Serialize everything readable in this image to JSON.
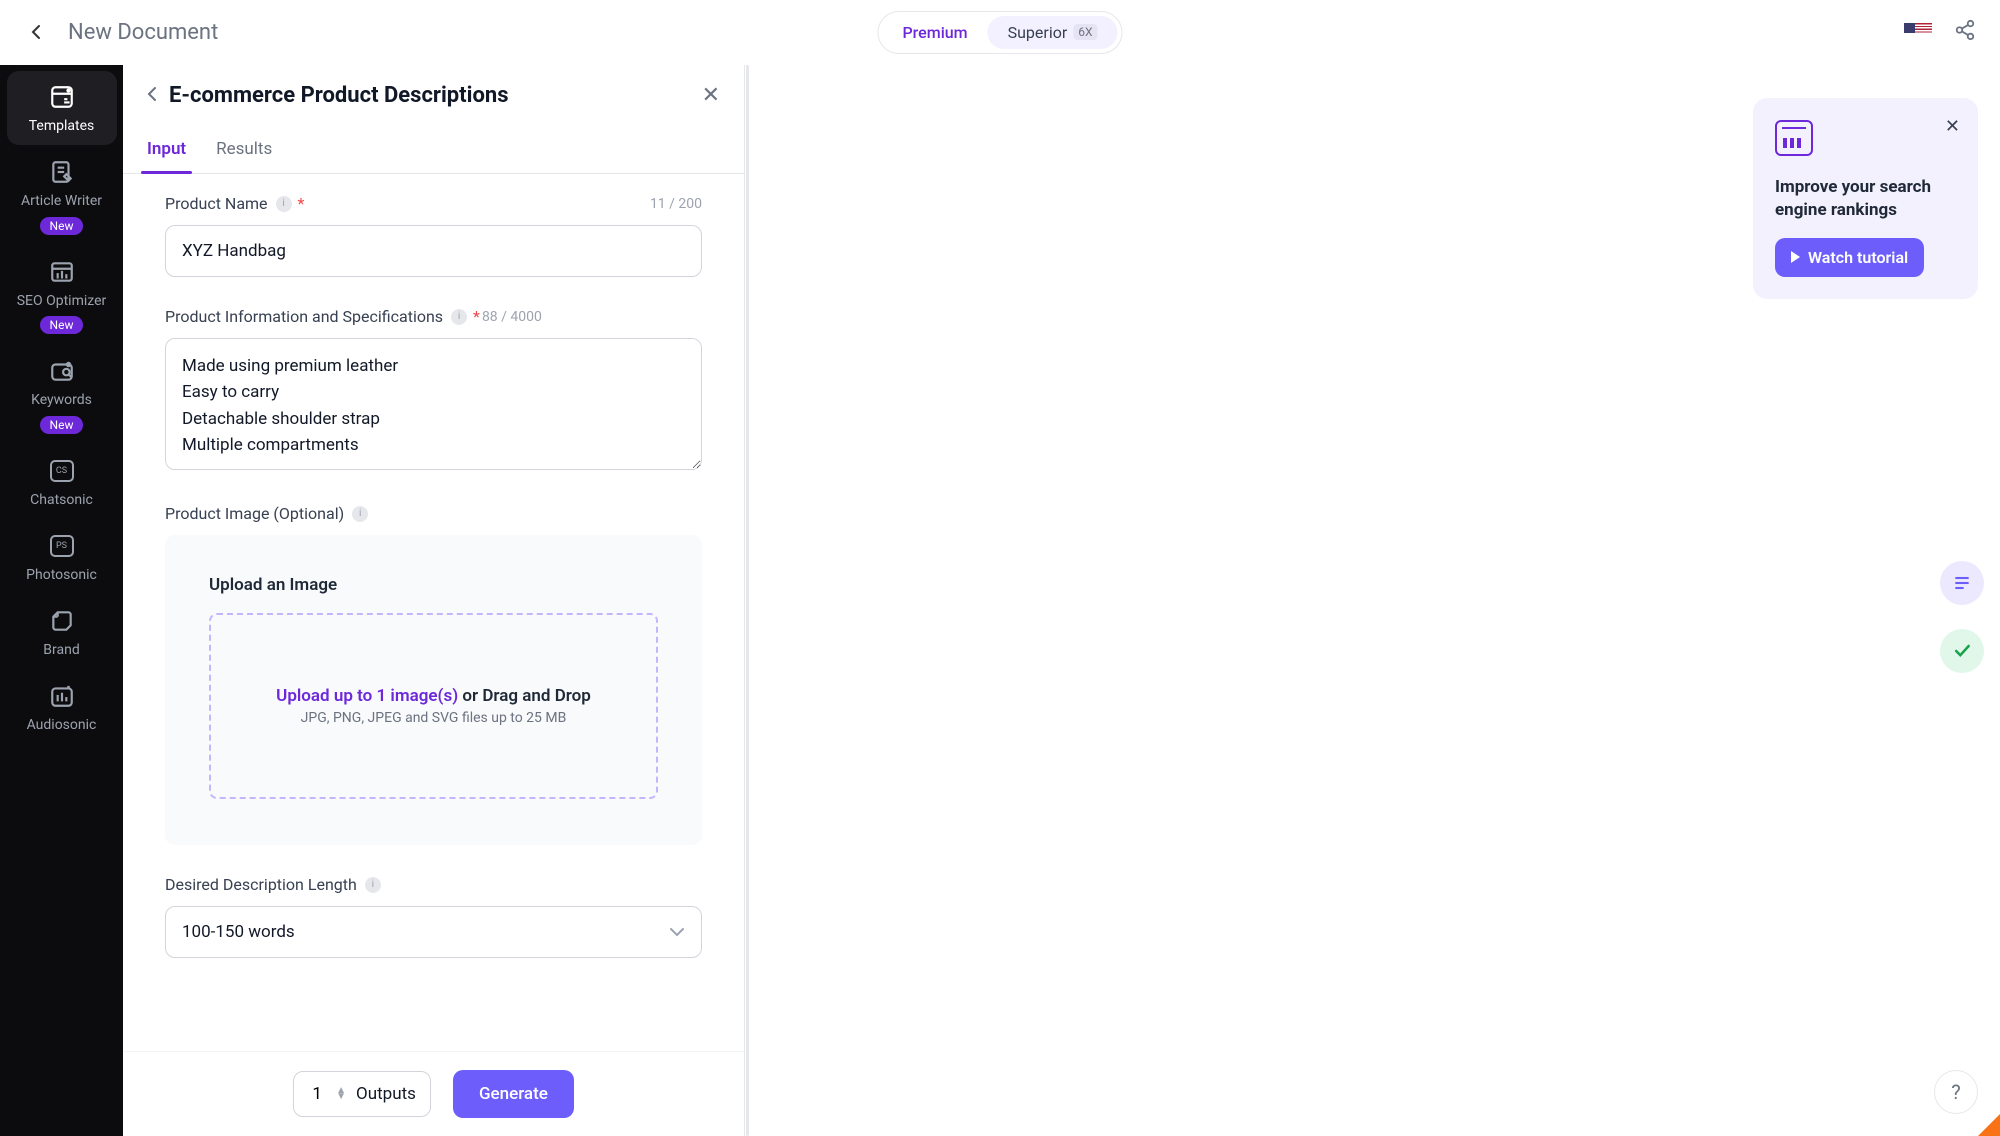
{
  "header": {
    "doc_title": "New Document",
    "plan_premium": "Premium",
    "plan_superior": "Superior",
    "plan_badge": "6X"
  },
  "sidebar": {
    "new_badge": "New",
    "items": [
      {
        "label": "Templates"
      },
      {
        "label": "Article Writer"
      },
      {
        "label": "SEO Optimizer"
      },
      {
        "label": "Keywords"
      },
      {
        "label": "Chatsonic",
        "icon_text": "CS"
      },
      {
        "label": "Photosonic",
        "icon_text": "PS"
      },
      {
        "label": "Brand"
      },
      {
        "label": "Audiosonic"
      }
    ]
  },
  "panel": {
    "title": "E-commerce Product Descriptions",
    "tabs": {
      "input": "Input",
      "results": "Results"
    },
    "product_name": {
      "label": "Product Name",
      "value": "XYZ Handbag",
      "count": "11 / 200"
    },
    "product_info": {
      "label": "Product Information and Specifications",
      "value": "Made using premium leather\nEasy to carry\nDetachable shoulder strap\nMultiple compartments",
      "count": "88 / 4000"
    },
    "product_image": {
      "label": "Product Image (Optional)",
      "upload_title": "Upload an Image",
      "upload_link": "Upload up to 1 image(s)",
      "upload_rest": " or Drag and Drop",
      "upload_sub": "JPG, PNG, JPEG and SVG files up to 25 MB"
    },
    "length": {
      "label": "Desired Description Length",
      "value": "100-150 words"
    }
  },
  "footer": {
    "outputs_count": "1",
    "outputs_label": "Outputs",
    "generate": "Generate"
  },
  "tutorial": {
    "title": "Improve your search engine rankings",
    "button": "Watch tutorial"
  }
}
